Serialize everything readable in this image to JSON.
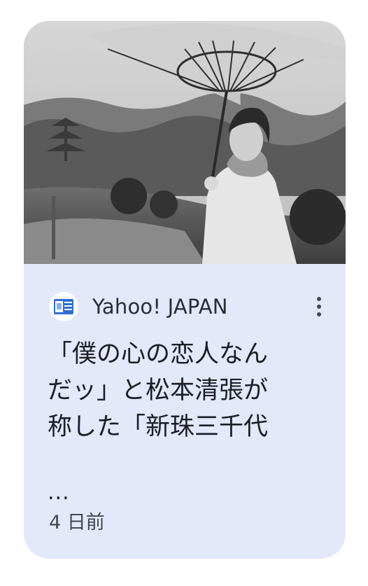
{
  "card": {
    "source": {
      "name": "Yahoo! JAPAN",
      "icon": "yahoo-news-favicon"
    },
    "more_icon": "more-vert-icon",
    "title_lines": [
      "「僕の心の恋人なん",
      "だッ」と松本清張が",
      "称した「新珠三千代"
    ],
    "title_ellipsis": "...",
    "timestamp": "4 日前"
  },
  "colors": {
    "card_bg": "#e3e8fb",
    "text_primary": "#1c1e24",
    "text_secondary": "#44474e"
  }
}
